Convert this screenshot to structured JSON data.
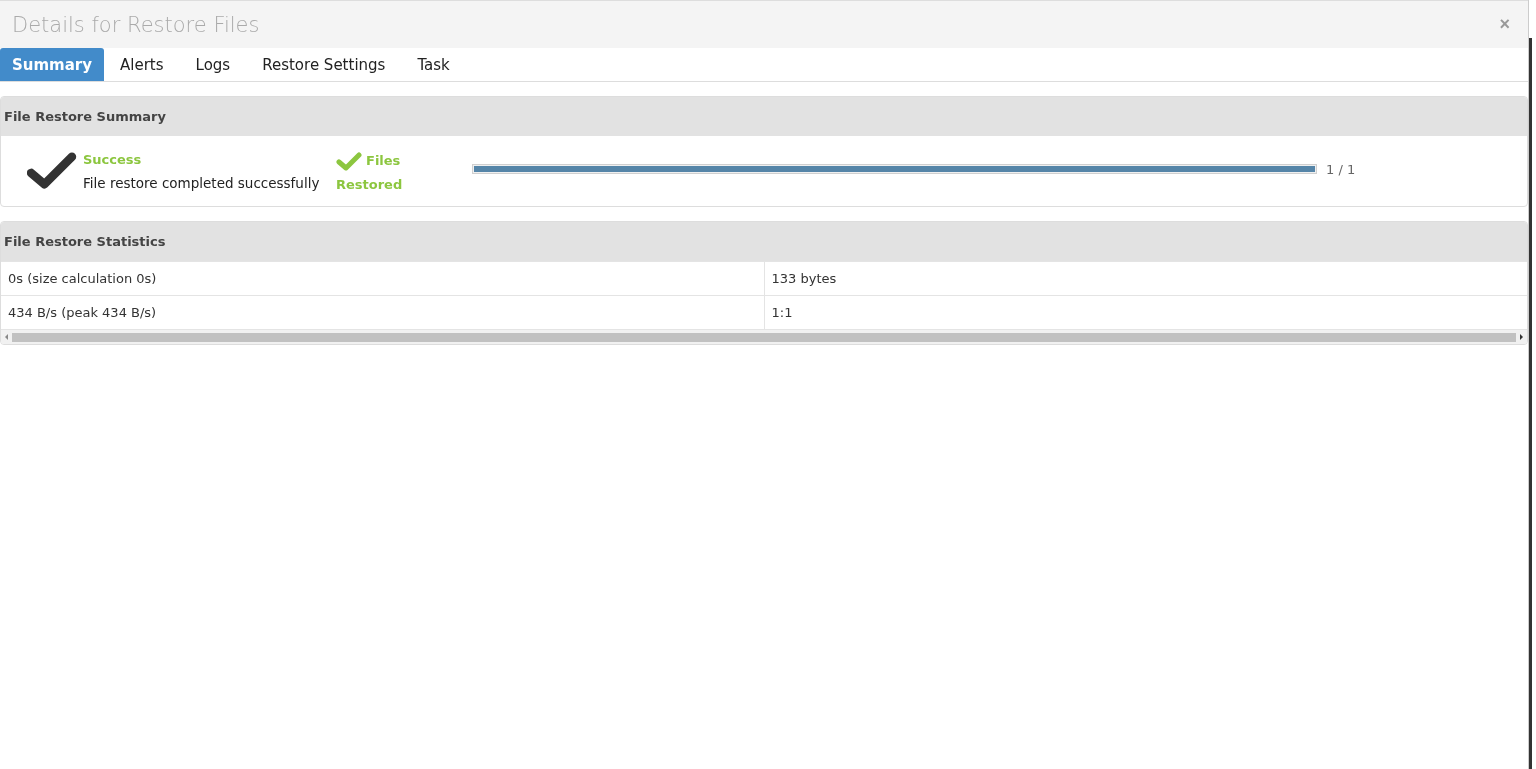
{
  "window": {
    "title": "Details for Restore Files",
    "close": "×"
  },
  "tabs": [
    {
      "label": "Summary",
      "selected": true
    },
    {
      "label": "Alerts",
      "selected": false
    },
    {
      "label": "Logs",
      "selected": false
    },
    {
      "label": "Restore Settings",
      "selected": false
    },
    {
      "label": "Task",
      "selected": false
    }
  ],
  "summary": {
    "heading": "File Restore Summary",
    "status": "Success",
    "message": "File restore completed successfully",
    "files_label": "Files",
    "restored_label": "Restored",
    "level": 1,
    "count": "1 / 1"
  },
  "statistics": {
    "heading": "File Restore Statistics",
    "rows": [
      [
        "0s (size calculation 0s)",
        "133 bytes"
      ],
      [
        "434 B/s (peak 434 B/s)",
        "1:1"
      ]
    ]
  }
}
